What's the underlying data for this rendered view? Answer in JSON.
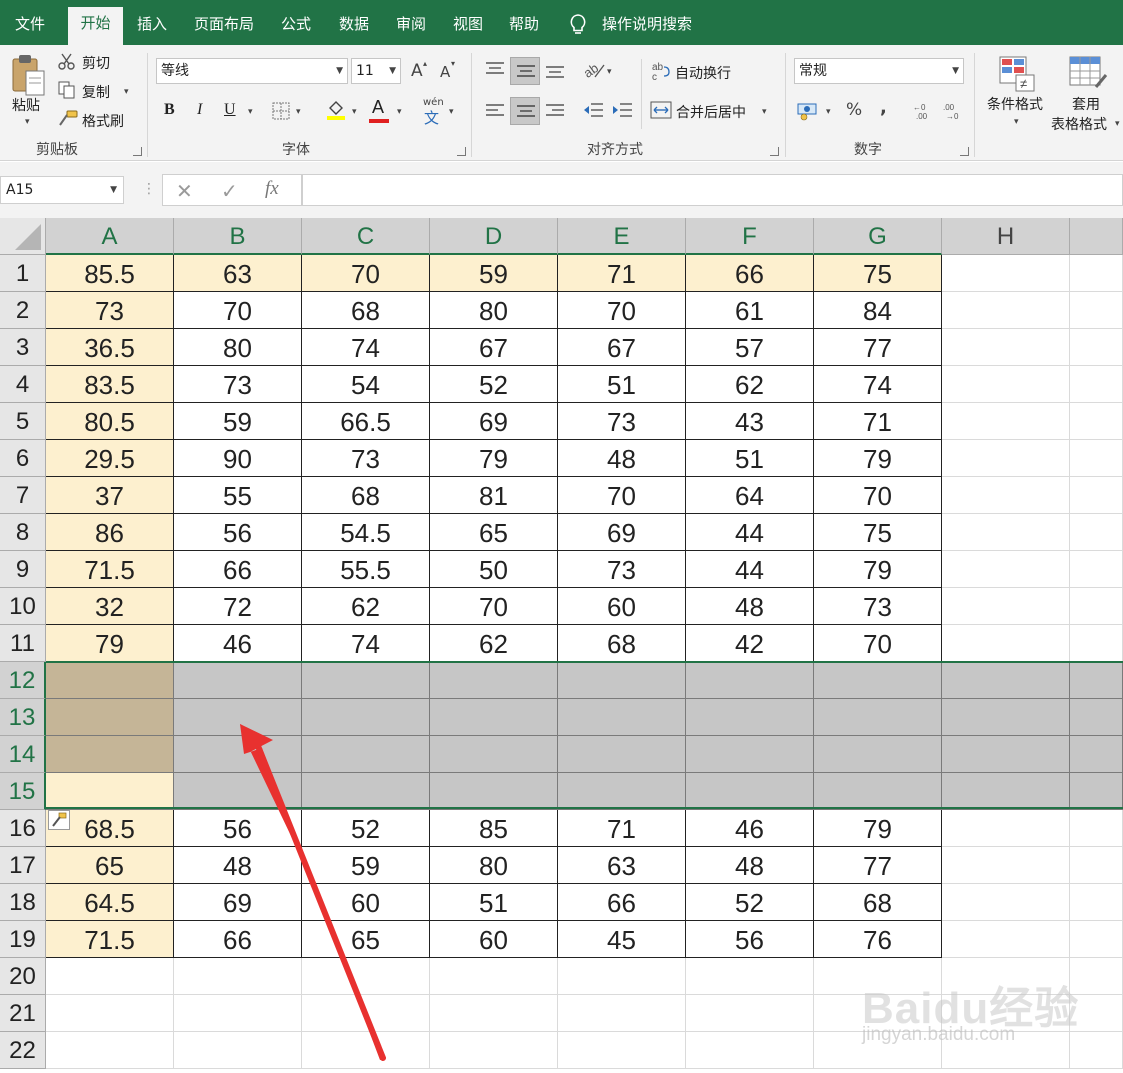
{
  "menu": {
    "tabs": [
      "文件",
      "开始",
      "插入",
      "页面布局",
      "公式",
      "数据",
      "审阅",
      "视图",
      "帮助"
    ],
    "active": "开始",
    "tell_me": "操作说明搜索"
  },
  "ribbon": {
    "clipboard": {
      "paste": "粘贴",
      "cut": "剪切",
      "copy": "复制",
      "format_painter": "格式刷",
      "label": "剪贴板"
    },
    "font": {
      "name": "等线",
      "size": "11",
      "grow": "A",
      "shrink": "A",
      "bold": "B",
      "italic": "I",
      "underline": "U",
      "font_color": "A",
      "phonetic": "wén",
      "phonetic_char": "文",
      "label": "字体"
    },
    "alignment": {
      "wrap_text": "自动换行",
      "merge_center": "合并后居中",
      "label": "对齐方式"
    },
    "number": {
      "format": "常规",
      "percent": "%",
      "comma": ",",
      "label": "数字"
    },
    "styles": {
      "conditional": "条件格式",
      "table_format_1": "套用",
      "table_format_2": "表格格式"
    }
  },
  "formula_bar": {
    "name_box": "A15",
    "fx": "fx",
    "content": ""
  },
  "sheet": {
    "columns": [
      "A",
      "B",
      "C",
      "D",
      "E",
      "F",
      "G",
      "H"
    ],
    "row_numbers": [
      "1",
      "2",
      "3",
      "4",
      "5",
      "6",
      "7",
      "8",
      "9",
      "10",
      "11",
      "12",
      "13",
      "14",
      "15",
      "16",
      "17",
      "18",
      "19",
      "20",
      "21",
      "22"
    ],
    "rows": [
      [
        "85.5",
        "63",
        "70",
        "59",
        "71",
        "66",
        "75"
      ],
      [
        "73",
        "70",
        "68",
        "80",
        "70",
        "61",
        "84"
      ],
      [
        "36.5",
        "80",
        "74",
        "67",
        "67",
        "57",
        "77"
      ],
      [
        "83.5",
        "73",
        "54",
        "52",
        "51",
        "62",
        "74"
      ],
      [
        "80.5",
        "59",
        "66.5",
        "69",
        "73",
        "43",
        "71"
      ],
      [
        "29.5",
        "90",
        "73",
        "79",
        "48",
        "51",
        "79"
      ],
      [
        "37",
        "55",
        "68",
        "81",
        "70",
        "64",
        "70"
      ],
      [
        "86",
        "56",
        "54.5",
        "65",
        "69",
        "44",
        "75"
      ],
      [
        "71.5",
        "66",
        "55.5",
        "50",
        "73",
        "44",
        "79"
      ],
      [
        "32",
        "72",
        "62",
        "70",
        "60",
        "48",
        "73"
      ],
      [
        "79",
        "46",
        "74",
        "62",
        "68",
        "42",
        "70"
      ],
      [
        "",
        "",
        "",
        "",
        "",
        "",
        ""
      ],
      [
        "",
        "",
        "",
        "",
        "",
        "",
        ""
      ],
      [
        "",
        "",
        "",
        "",
        "",
        "",
        ""
      ],
      [
        "",
        "",
        "",
        "",
        "",
        "",
        ""
      ],
      [
        "68.5",
        "56",
        "52",
        "85",
        "71",
        "46",
        "79"
      ],
      [
        "65",
        "48",
        "59",
        "80",
        "63",
        "48",
        "77"
      ],
      [
        "64.5",
        "69",
        "60",
        "51",
        "66",
        "52",
        "68"
      ],
      [
        "71.5",
        "66",
        "65",
        "60",
        "45",
        "56",
        "76"
      ]
    ],
    "selected_rows": [
      "12",
      "13",
      "14",
      "15"
    ],
    "active_cell": "A15"
  },
  "colors": {
    "excel_green": "#217346",
    "highlight": "#fdf0cf",
    "selection": "#c6c6c6",
    "arrow": "#e8312f"
  },
  "watermark": {
    "line1": "Baidu经验",
    "line2": "jingyan.baidu.com"
  }
}
